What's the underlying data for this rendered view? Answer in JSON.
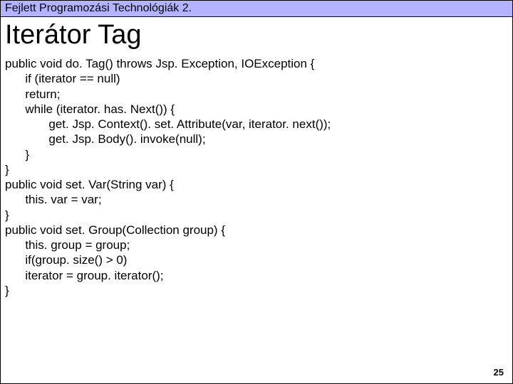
{
  "header": {
    "text": "Fejlett Programozási Technológiák 2."
  },
  "title": "Iterátor Tag",
  "code_lines": [
    "public void do. Tag() throws Jsp. Exception, IOException {",
    "      if (iterator == null)",
    "      return;",
    "      while (iterator. has. Next()) {",
    "             get. Jsp. Context(). set. Attribute(var, iterator. next());",
    "             get. Jsp. Body(). invoke(null);",
    "      }",
    "}",
    "public void set. Var(String var) {",
    "      this. var = var;",
    "}",
    "public void set. Group(Collection group) {",
    "      this. group = group;",
    "      if(group. size() > 0)",
    "      iterator = group. iterator();",
    "}"
  ],
  "page_number": "25"
}
